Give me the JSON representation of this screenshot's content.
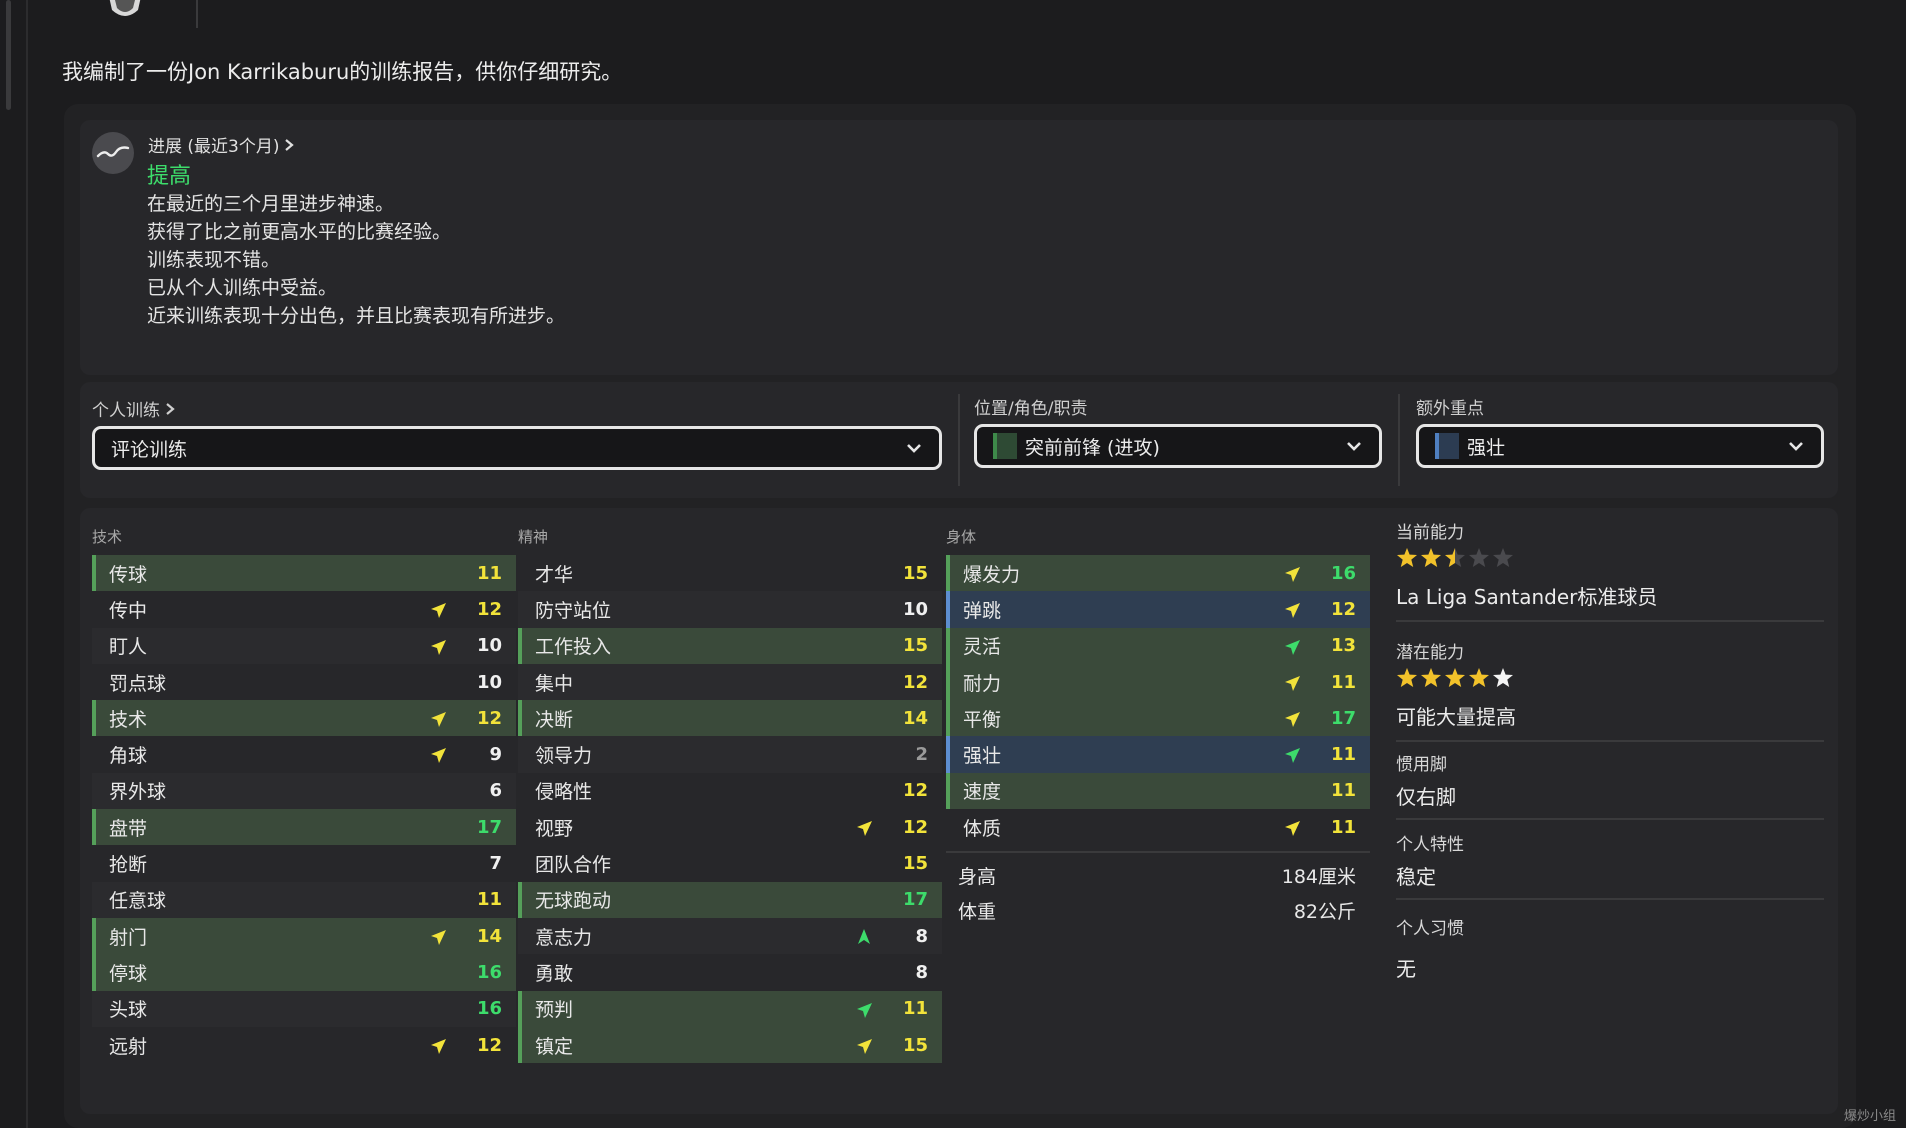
{
  "intro": "我编制了一份Jon Karrikaburu的训练报告，供你仔细研究。",
  "progress": {
    "title": "进展 (最近3个月)",
    "status": "提高",
    "lines": [
      "在最近的三个月里进步神速。",
      "获得了比之前更高水平的比赛经验。",
      "训练表现不错。",
      "已从个人训练中受益。",
      "近来训练表现十分出色，并且比赛表现有所进步。"
    ]
  },
  "training": {
    "individual_label": "个人训练",
    "individual_value": "评论训练",
    "role_label": "位置/角色/职责",
    "role_value": "突前前锋 (进攻)",
    "role_color": "#3e8a4a",
    "focus_label": "额外重点",
    "focus_value": "强壮",
    "focus_color": "#4f7fc0"
  },
  "colors": {
    "green": "#3ddc6b",
    "yellow": "#f2e33a",
    "white": "#f0f0f0",
    "grey": "#9a9a9a"
  },
  "attributes": {
    "technical": {
      "header": "技术",
      "rows": [
        {
          "name": "传球",
          "value": "11",
          "hl": "hl",
          "arrow": "",
          "color": "yellow"
        },
        {
          "name": "传中",
          "value": "12",
          "hl": "plain",
          "arrow": "up-right",
          "color": "yellow"
        },
        {
          "name": "盯人",
          "value": "10",
          "hl": "alt",
          "arrow": "up-right",
          "color": "white"
        },
        {
          "name": "罚点球",
          "value": "10",
          "hl": "plain",
          "arrow": "",
          "color": "white"
        },
        {
          "name": "技术",
          "value": "12",
          "hl": "hl",
          "arrow": "up-right",
          "color": "yellow"
        },
        {
          "name": "角球",
          "value": "9",
          "hl": "plain",
          "arrow": "up-right",
          "color": "white"
        },
        {
          "name": "界外球",
          "value": "6",
          "hl": "alt",
          "arrow": "",
          "color": "white"
        },
        {
          "name": "盘带",
          "value": "17",
          "hl": "hl",
          "arrow": "",
          "color": "green"
        },
        {
          "name": "抢断",
          "value": "7",
          "hl": "plain",
          "arrow": "",
          "color": "white"
        },
        {
          "name": "任意球",
          "value": "11",
          "hl": "alt",
          "arrow": "",
          "color": "yellow"
        },
        {
          "name": "射门",
          "value": "14",
          "hl": "hl",
          "arrow": "up-right",
          "color": "yellow"
        },
        {
          "name": "停球",
          "value": "16",
          "hl": "hl",
          "arrow": "",
          "color": "green"
        },
        {
          "name": "头球",
          "value": "16",
          "hl": "alt",
          "arrow": "",
          "color": "green"
        },
        {
          "name": "远射",
          "value": "12",
          "hl": "plain",
          "arrow": "up-right",
          "color": "yellow"
        }
      ]
    },
    "mental": {
      "header": "精神",
      "rows": [
        {
          "name": "才华",
          "value": "15",
          "hl": "plain",
          "arrow": "",
          "color": "yellow"
        },
        {
          "name": "防守站位",
          "value": "10",
          "hl": "alt",
          "arrow": "",
          "color": "white"
        },
        {
          "name": "工作投入",
          "value": "15",
          "hl": "hl",
          "arrow": "",
          "color": "yellow"
        },
        {
          "name": "集中",
          "value": "12",
          "hl": "alt",
          "arrow": "",
          "color": "yellow"
        },
        {
          "name": "决断",
          "value": "14",
          "hl": "hl",
          "arrow": "",
          "color": "yellow"
        },
        {
          "name": "领导力",
          "value": "2",
          "hl": "alt",
          "arrow": "",
          "color": "grey"
        },
        {
          "name": "侵略性",
          "value": "12",
          "hl": "plain",
          "arrow": "",
          "color": "yellow"
        },
        {
          "name": "视野",
          "value": "12",
          "hl": "plain",
          "arrow": "up-right",
          "color": "yellow"
        },
        {
          "name": "团队合作",
          "value": "15",
          "hl": "plain",
          "arrow": "",
          "color": "yellow"
        },
        {
          "name": "无球跑动",
          "value": "17",
          "hl": "hl",
          "arrow": "",
          "color": "green"
        },
        {
          "name": "意志力",
          "value": "8",
          "hl": "alt",
          "arrow": "up",
          "color": "white"
        },
        {
          "name": "勇敢",
          "value": "8",
          "hl": "plain",
          "arrow": "",
          "color": "white"
        },
        {
          "name": "预判",
          "value": "11",
          "hl": "hl",
          "arrow": "up-right-green",
          "color": "yellow"
        },
        {
          "name": "镇定",
          "value": "15",
          "hl": "hl",
          "arrow": "up-right",
          "color": "yellow"
        }
      ]
    },
    "physical": {
      "header": "身体",
      "rows": [
        {
          "name": "爆发力",
          "value": "16",
          "hl": "hl",
          "arrow": "up-right",
          "color": "green"
        },
        {
          "name": "弹跳",
          "value": "12",
          "hl": "hl-blue",
          "arrow": "up-right",
          "color": "yellow"
        },
        {
          "name": "灵活",
          "value": "13",
          "hl": "hl",
          "arrow": "up-right-green",
          "color": "yellow"
        },
        {
          "name": "耐力",
          "value": "11",
          "hl": "hl",
          "arrow": "up-right",
          "color": "yellow"
        },
        {
          "name": "平衡",
          "value": "17",
          "hl": "hl",
          "arrow": "up-right",
          "color": "green"
        },
        {
          "name": "强壮",
          "value": "11",
          "hl": "hl-blue",
          "arrow": "up-right-green",
          "color": "yellow"
        },
        {
          "name": "速度",
          "value": "11",
          "hl": "hl",
          "arrow": "",
          "color": "yellow"
        },
        {
          "name": "体质",
          "value": "11",
          "hl": "plain",
          "arrow": "up-right",
          "color": "yellow"
        }
      ],
      "height_label": "身高",
      "height_value": "184厘米",
      "weight_label": "体重",
      "weight_value": "82公斤"
    }
  },
  "info": {
    "ca_label": "当前能力",
    "ca_stars": 2.5,
    "ca_text": "La Liga Santander标准球员",
    "pa_label": "潜在能力",
    "pa_stars": 4.5,
    "pa_text": "可能大量提高",
    "foot_label": "惯用脚",
    "foot_value": "仅右脚",
    "traits_label": "个人特性",
    "traits_value": "稳定",
    "habits_label": "个人习惯",
    "habits_value": "无"
  },
  "watermark": "爆炒小组"
}
